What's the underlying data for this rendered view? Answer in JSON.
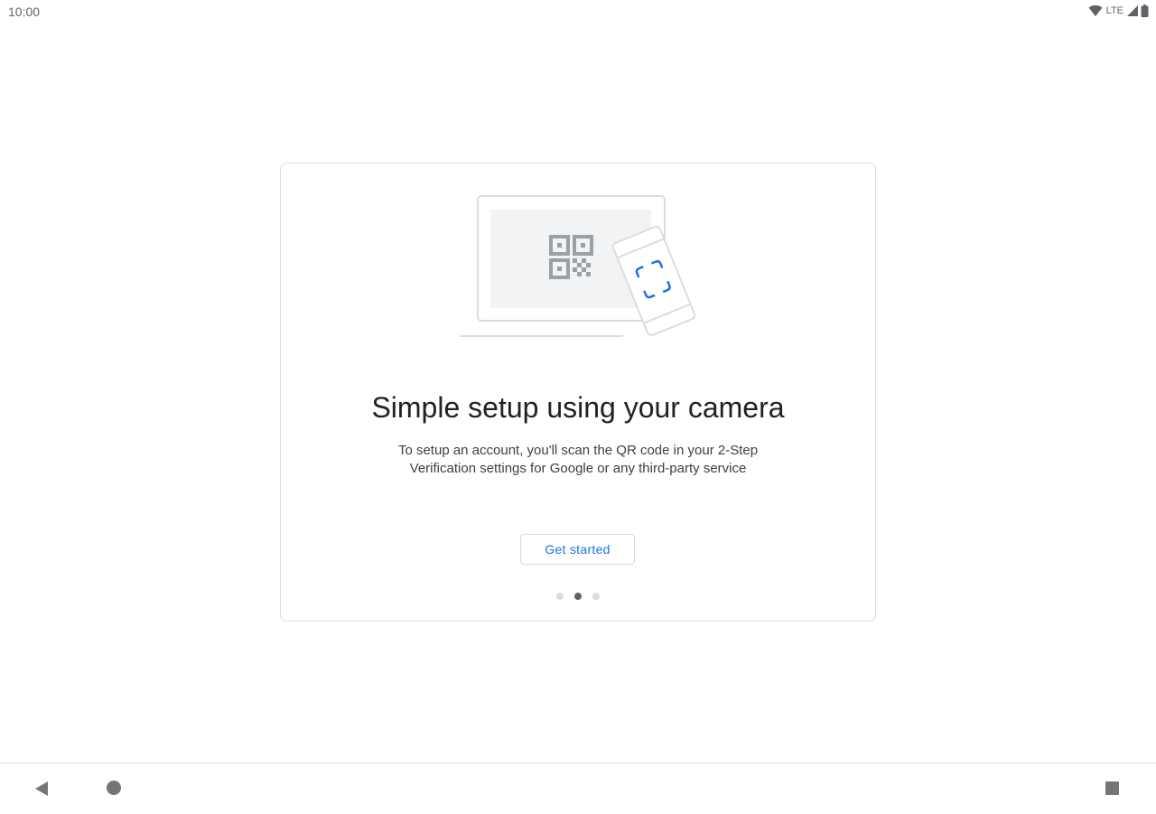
{
  "status_bar": {
    "time": "10:00",
    "network_label": "LTE",
    "icons": [
      "wifi-icon",
      "signal-icon",
      "battery-icon"
    ]
  },
  "card": {
    "illustration": "qr-scan-illustration",
    "title": "Simple setup using your camera",
    "body": "To setup an account, you'll scan the QR code in your 2-Step Verification settings for Google or any third-party service",
    "button_label": "Get started",
    "pager": {
      "total": 3,
      "active_index": 1
    }
  },
  "nav_bar": {
    "icons": [
      "back-icon",
      "home-icon",
      "recents-icon"
    ]
  },
  "colors": {
    "accent": "#1a73e8",
    "border": "#dadce0",
    "text_primary": "#202124",
    "text_secondary": "#3c4043"
  }
}
